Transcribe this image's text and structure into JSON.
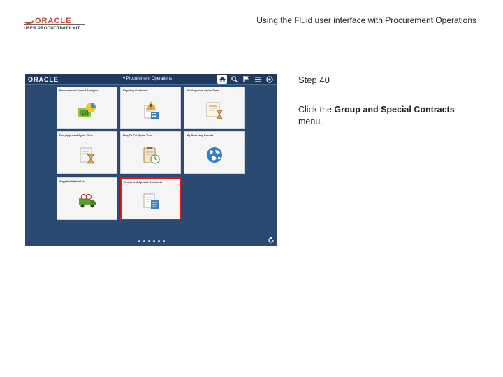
{
  "header": {
    "logo_brand": "ORACLE",
    "logo_product": "USER PRODUCTIVITY KIT",
    "document_title": "Using the Fluid user interface with Procurement Operations"
  },
  "screenshot": {
    "banner": {
      "brand": "ORACLE",
      "title": "▾ Procurement Operations"
    },
    "tiles": [
      {
        "title": "Procurement Spend Analysis",
        "icon": "chart-money-icon"
      },
      {
        "title": "Expiring Contracts",
        "icon": "warning-calendar-icon"
      },
      {
        "title": "PO Approval Cycle Time",
        "icon": "document-hourglass-icon"
      },
      {
        "title": "Req Approval Cycle Time",
        "icon": "hourglass-icon"
      },
      {
        "title": "Req To PO Cycle Time",
        "icon": "clipboard-clock-icon"
      },
      {
        "title": "My Sourcing Events",
        "icon": "globe-icon"
      },
      {
        "title": "Supplier Watch List",
        "icon": "truck-icon"
      },
      {
        "title": "Group and Special Contracts",
        "icon": "documents-icon"
      }
    ],
    "page_dots": 6,
    "selected_tile": "Group and Special Contracts"
  },
  "instructions": {
    "step": "Step 40",
    "text_before": "Click the ",
    "target_bold": "Group and Special Contracts",
    "text_after": " menu."
  },
  "colors": {
    "oracle_red": "#c74634",
    "banner": "#1f3a5e",
    "background": "#2b4a71",
    "highlight": "#e0151b"
  }
}
